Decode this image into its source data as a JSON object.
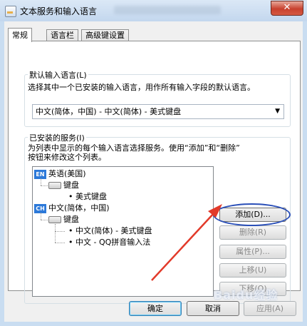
{
  "window": {
    "title": "文本服务和输入语言",
    "close_symbol": "✕"
  },
  "tabs": [
    {
      "label": "常规"
    },
    {
      "label": "语言栏"
    },
    {
      "label": "高级键设置"
    }
  ],
  "default_language": {
    "group_label": "默认输入语言(L)",
    "description": "选择其中一个已安装的输入语言，用作所有输入字段的默认语言。",
    "selected": "中文(简体，中国) - 中文(简体) - 美式键盘",
    "dropdown_arrow": "▼"
  },
  "installed_services": {
    "group_label": "已安装的服务(I)",
    "description_line1": "为列表中显示的每个输入语言选择服务。使用“添加”和“删除”",
    "description_line2": "按钮来修改这个列表。",
    "tree": [
      {
        "badge": "EN",
        "label": "英语(美国)"
      },
      {
        "label": "键盘"
      },
      {
        "bullet": "•",
        "label": "美式键盘"
      },
      {
        "badge": "CH",
        "label": "中文(简体，中国)"
      },
      {
        "label": "键盘"
      },
      {
        "bullet": "•",
        "label": "中文(简体) - 美式键盘"
      },
      {
        "bullet": "•",
        "label": "中文 - QQ拼音输入法"
      }
    ],
    "buttons": {
      "add": "添加(D)...",
      "remove": "删除(R)",
      "properties": "属性(P)...",
      "move_up": "上移(U)",
      "move_down": "下移(O)"
    }
  },
  "footer": {
    "ok": "确定",
    "cancel": "取消",
    "apply": "应用(A)"
  },
  "annotation_colors": {
    "ellipse": "#2a4fb8",
    "arrow": "#e23a2a"
  }
}
